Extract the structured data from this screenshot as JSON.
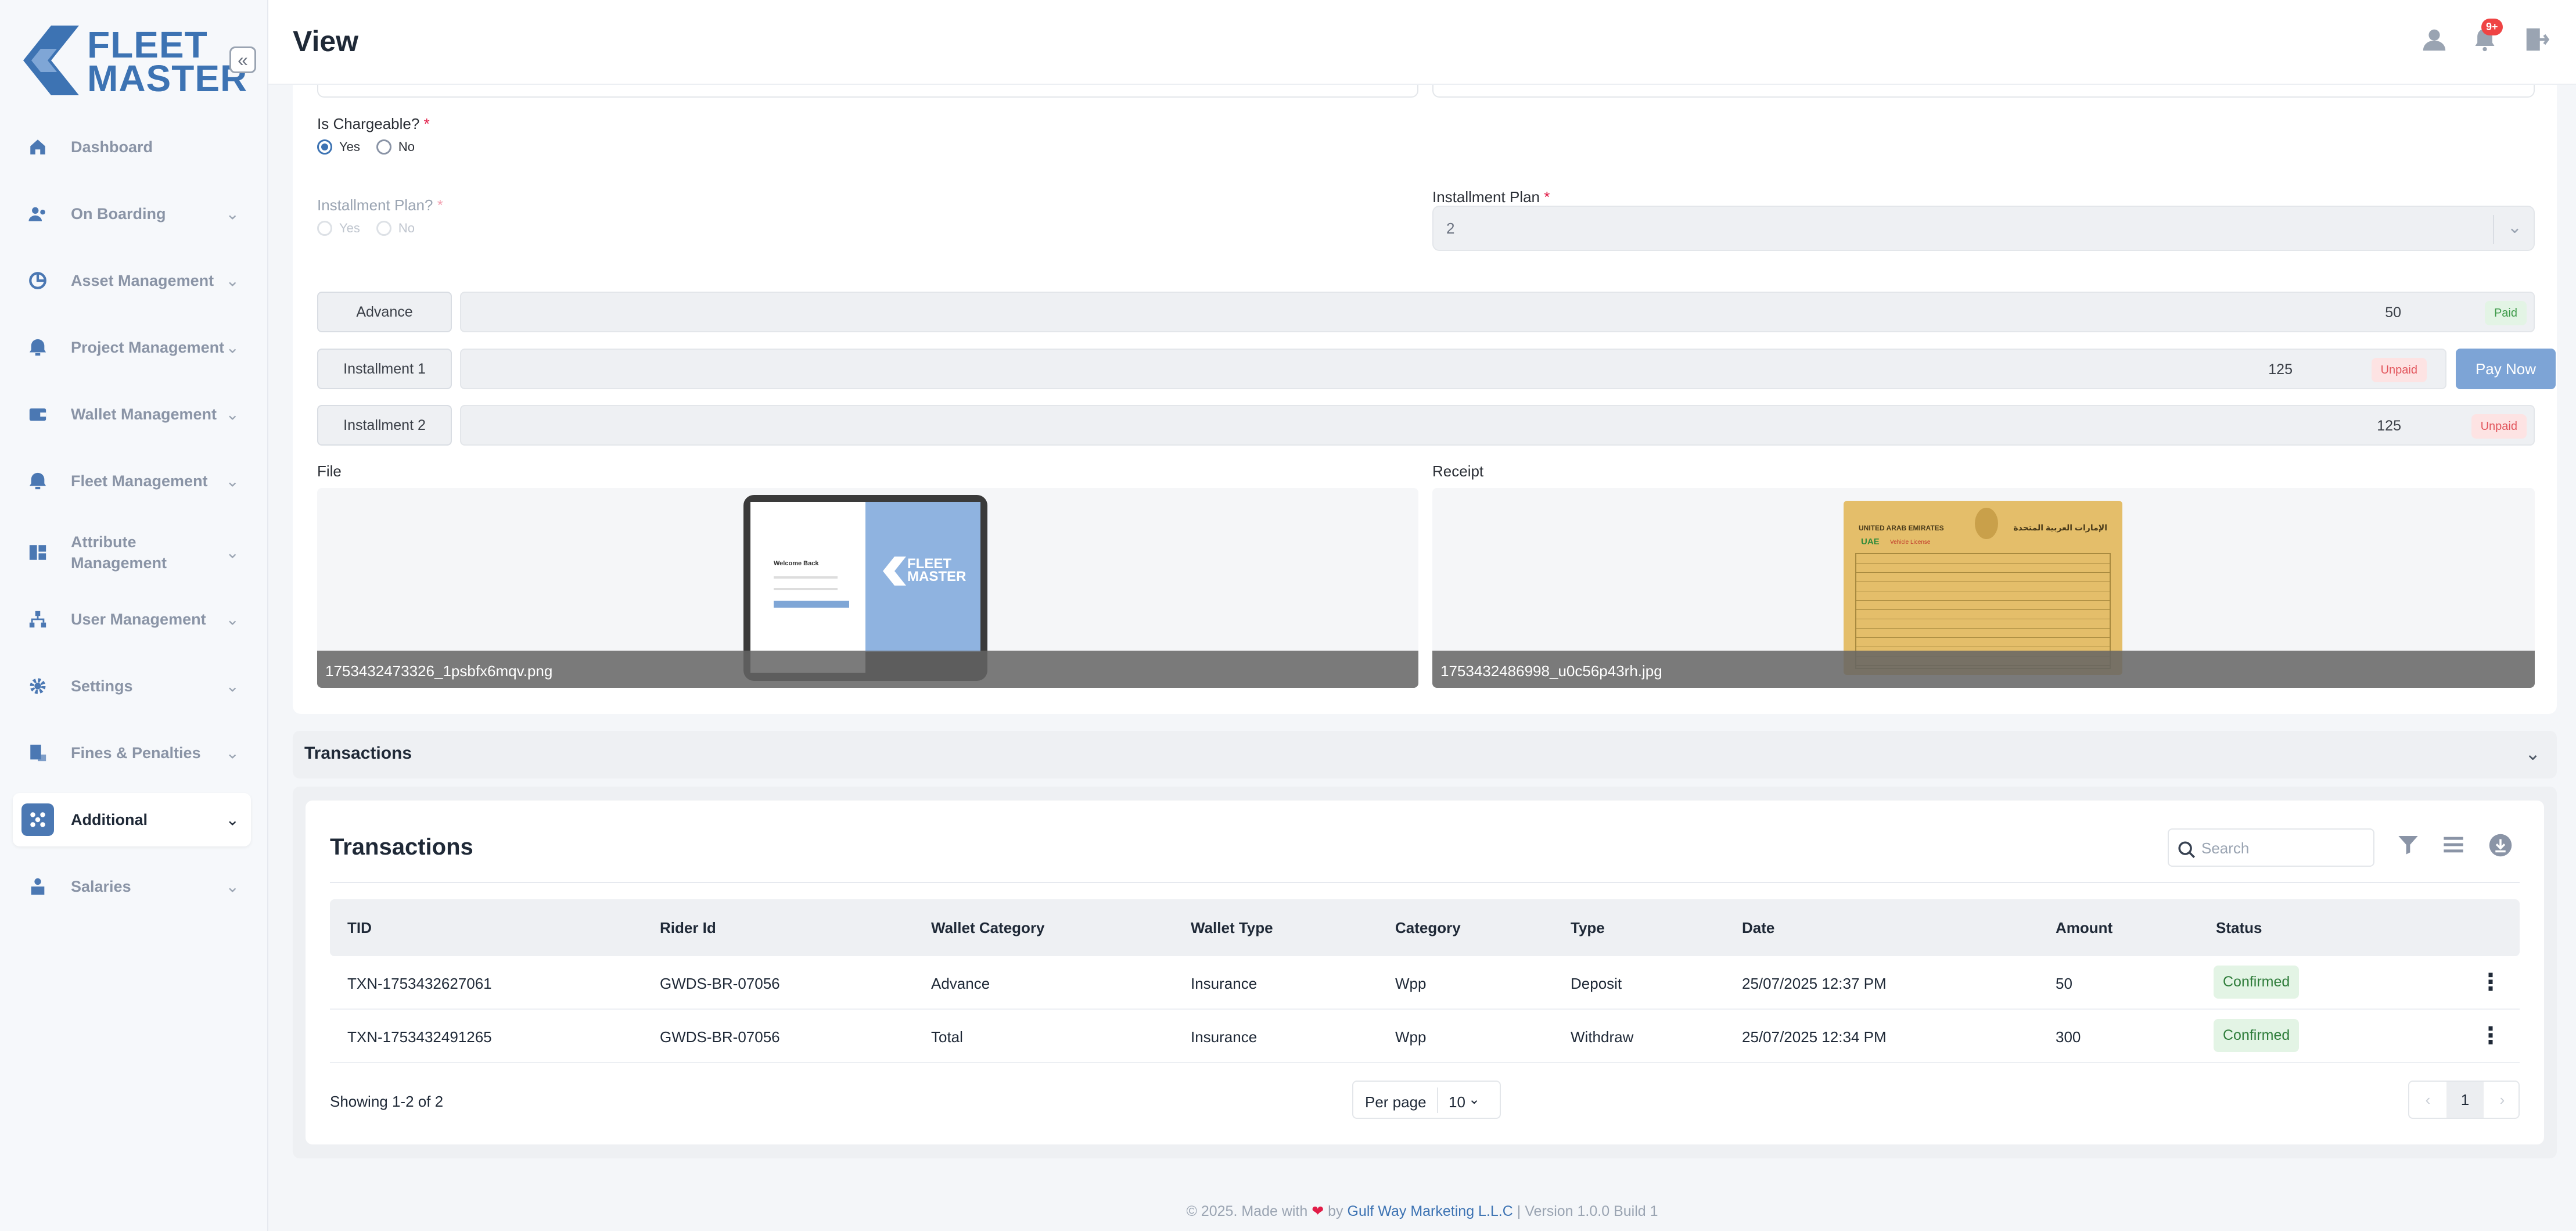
{
  "app": {
    "logo_line1": "FLEET",
    "logo_line2": "MASTER",
    "page_title": "View",
    "notification_count": "9+"
  },
  "sidebar": {
    "items": [
      {
        "label": "Dashboard",
        "icon": "home-icon"
      },
      {
        "label": "On Boarding",
        "icon": "onboarding-icon"
      },
      {
        "label": "Asset Management",
        "icon": "asset-icon"
      },
      {
        "label": "Project Management",
        "icon": "project-icon"
      },
      {
        "label": "Wallet Management",
        "icon": "wallet-icon"
      },
      {
        "label": "Fleet Management",
        "icon": "fleet-icon"
      },
      {
        "label": "Attribute Management",
        "icon": "attribute-icon"
      },
      {
        "label": "User Management",
        "icon": "users-icon"
      },
      {
        "label": "Settings",
        "icon": "gear-icon"
      },
      {
        "label": "Fines & Penalties",
        "icon": "fines-icon"
      },
      {
        "label": "Additional",
        "icon": "additional-icon"
      },
      {
        "label": "Salaries",
        "icon": "salaries-icon"
      }
    ],
    "active": "Additional"
  },
  "form": {
    "chargeable_label": "Is Chargeable?",
    "chargeable_yes": "Yes",
    "chargeable_no": "No",
    "chargeable_value": "Yes",
    "installment_q_label": "Installment Plan?",
    "installment_q_yes": "Yes",
    "installment_q_no": "No",
    "installment_plan_label": "Installment Plan",
    "installment_plan_value": "2",
    "installments": [
      {
        "label": "Advance",
        "amount": "50",
        "status": "Paid"
      },
      {
        "label": "Installment 1",
        "amount": "125",
        "status": "Unpaid",
        "action": "Pay Now"
      },
      {
        "label": "Installment 2",
        "amount": "125",
        "status": "Unpaid"
      }
    ],
    "file_label": "File",
    "file_name": "1753432473326_1psbfx6mqv.png",
    "receipt_label": "Receipt",
    "receipt_name": "1753432486998_u0c56p43rh.jpg",
    "preview_welcome": "Welcome Back",
    "receipt_header_en": "UNITED ARAB EMIRATES",
    "receipt_header_ar": "الإمارات العربية المتحدة",
    "receipt_uae": "UAE",
    "receipt_subtitle": "Vehicle License"
  },
  "accordion": {
    "title": "Transactions"
  },
  "transactions": {
    "title": "Transactions",
    "search_placeholder": "Search",
    "columns": [
      "TID",
      "Rider Id",
      "Wallet Category",
      "Wallet Type",
      "Category",
      "Type",
      "Date",
      "Amount",
      "Status"
    ],
    "rows": [
      {
        "tid": "TXN-1753432627061",
        "rider": "GWDS-BR-07056",
        "wallet_category": "Advance",
        "wallet_type": "Insurance",
        "category": "Wpp",
        "type": "Deposit",
        "date": "25/07/2025 12:37 PM",
        "amount": "50",
        "status": "Confirmed"
      },
      {
        "tid": "TXN-1753432491265",
        "rider": "GWDS-BR-07056",
        "wallet_category": "Total",
        "wallet_type": "Insurance",
        "category": "Wpp",
        "type": "Withdraw",
        "date": "25/07/2025 12:34 PM",
        "amount": "300",
        "status": "Confirmed"
      }
    ],
    "showing": "Showing 1-2 of 2",
    "per_page_label": "Per page",
    "per_page_value": "10",
    "current_page": "1"
  },
  "footer": {
    "prefix": "© 2025. Made with",
    "by": "by",
    "company": "Gulf Way Marketing L.L.C",
    "version": "| Version 1.0.0 Build 1"
  },
  "colors": {
    "brand": "#3d73b3",
    "paid": "#3d9a49",
    "unpaid": "#e2545b",
    "pay_button": "#7da4d6",
    "confirmed_bg": "#e3f4e5"
  }
}
